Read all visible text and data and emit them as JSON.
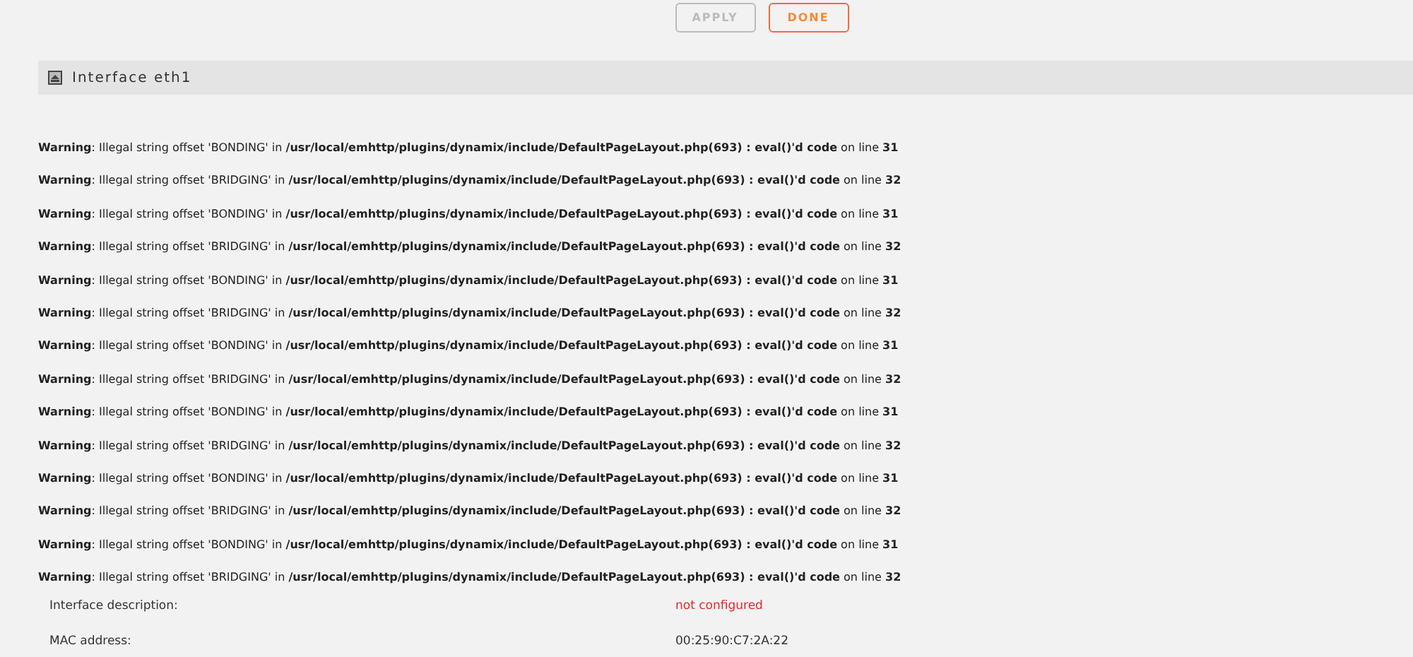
{
  "buttons": [
    {
      "label": "APPLY",
      "disabled": true
    },
    {
      "label": "DONE",
      "disabled": false
    }
  ],
  "section": {
    "title": "Interface eth1"
  },
  "warnings": [
    "**Warning**: Illegal string offset 'BONDING' in **/usr/local/emhttp/plugins/dynamix/include/DefaultPageLayout.php(693) : eval()'d code** on line **31**",
    "**Warning**: Illegal string offset 'BRIDGING' in **/usr/local/emhttp/plugins/dynamix/include/DefaultPageLayout.php(693) : eval()'d code** on line **32**",
    "**Warning**: Illegal string offset 'BONDING' in **/usr/local/emhttp/plugins/dynamix/include/DefaultPageLayout.php(693) : eval()'d code** on line **31**",
    "**Warning**: Illegal string offset 'BRIDGING' in **/usr/local/emhttp/plugins/dynamix/include/DefaultPageLayout.php(693) : eval()'d code** on line **32**",
    "**Warning**: Illegal string offset 'BONDING' in **/usr/local/emhttp/plugins/dynamix/include/DefaultPageLayout.php(693) : eval()'d code** on line **31**",
    "**Warning**: Illegal string offset 'BRIDGING' in **/usr/local/emhttp/plugins/dynamix/include/DefaultPageLayout.php(693) : eval()'d code** on line **32**",
    "**Warning**: Illegal string offset 'BONDING' in **/usr/local/emhttp/plugins/dynamix/include/DefaultPageLayout.php(693) : eval()'d code** on line **31**",
    "**Warning**: Illegal string offset 'BRIDGING' in **/usr/local/emhttp/plugins/dynamix/include/DefaultPageLayout.php(693) : eval()'d code** on line **32**",
    "**Warning**: Illegal string offset 'BONDING' in **/usr/local/emhttp/plugins/dynamix/include/DefaultPageLayout.php(693) : eval()'d code** on line **31**",
    "**Warning**: Illegal string offset 'BRIDGING' in **/usr/local/emhttp/plugins/dynamix/include/DefaultPageLayout.php(693) : eval()'d code** on line **32**",
    "**Warning**: Illegal string offset 'BONDING' in **/usr/local/emhttp/plugins/dynamix/include/DefaultPageLayout.php(693) : eval()'d code** on line **31**",
    "**Warning**: Illegal string offset 'BRIDGING' in **/usr/local/emhttp/plugins/dynamix/include/DefaultPageLayout.php(693) : eval()'d code** on line **32**",
    "**Warning**: Illegal string offset 'BONDING' in **/usr/local/emhttp/plugins/dynamix/include/DefaultPageLayout.php(693) : eval()'d code** on line **31**",
    "**Warning**: Illegal string offset 'BRIDGING' in **/usr/local/emhttp/plugins/dynamix/include/DefaultPageLayout.php(693) : eval()'d code** on line **32**"
  ],
  "fields": [
    {
      "label": "Interface description:",
      "value": "not configured",
      "kind": "warning"
    },
    {
      "label": "MAC address:",
      "value": "00:25:90:C7:2A:22",
      "kind": "plain"
    }
  ]
}
